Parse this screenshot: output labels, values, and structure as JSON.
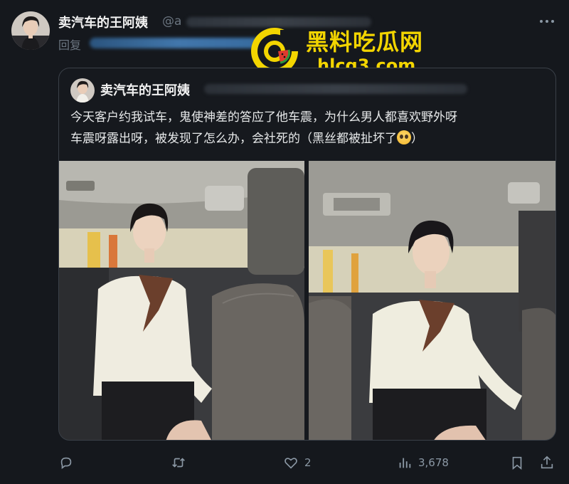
{
  "post": {
    "author_name": "卖汽车的王阿姨",
    "author_handle": "@a",
    "reply_prefix": "回复"
  },
  "watermark": {
    "site_name": "黑料吃瓜网",
    "site_url": "hlcg3.com"
  },
  "quoted": {
    "author_name": "卖汽车的王阿姨",
    "text_line1": "今天客户约我试车，鬼使神差的答应了他车震，为什么男人都喜欢野外呀",
    "text_line2": "车震呀露出呀，被发现了怎么办，会社死的（黑丝都被扯坏了"
  },
  "actions": {
    "reply_count": "",
    "retweet_count": "",
    "like_count": "2",
    "view_count": "3,678"
  },
  "icons": [
    "more-icon",
    "reply-icon",
    "retweet-icon",
    "like-icon",
    "views-icon",
    "bookmark-icon",
    "share-icon",
    "pleading-face-emoji"
  ],
  "colors": {
    "background": "#15181d",
    "text": "#e7e9ea",
    "muted": "#8b98a5",
    "watermark": "#f3d500"
  }
}
